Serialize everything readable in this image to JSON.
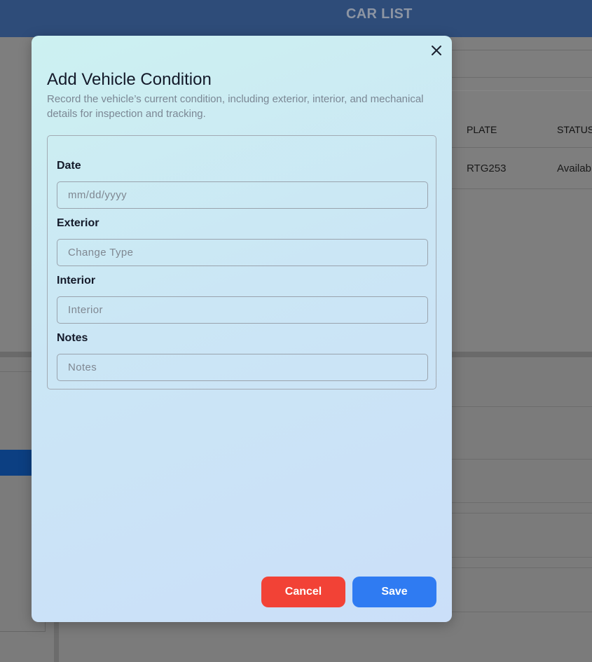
{
  "background": {
    "header_title": "CAR LIST",
    "table_headers": [
      "PLATE",
      "STATUS"
    ],
    "table_row": [
      "RTG253",
      "Availab"
    ]
  },
  "modal": {
    "title": "Add Vehicle Condition",
    "description": "Record the vehicle’s current condition, including exterior, interior, and mechanical details for inspection and tracking.",
    "fields": [
      {
        "label": "Date",
        "placeholder": "mm/dd/yyyy",
        "value": ""
      },
      {
        "label": "Exterior",
        "placeholder": "Change Type",
        "value": ""
      },
      {
        "label": "Interior",
        "placeholder": "Interior",
        "value": ""
      },
      {
        "label": "Notes",
        "placeholder": "Notes",
        "value": ""
      }
    ],
    "cancel_label": "Cancel",
    "save_label": "Save",
    "close_icon": "close-icon"
  },
  "colors": {
    "header": "#2e4c79",
    "cancel": "#f24236",
    "save": "#2f7bf2",
    "overlay": "#7d7d7d"
  }
}
